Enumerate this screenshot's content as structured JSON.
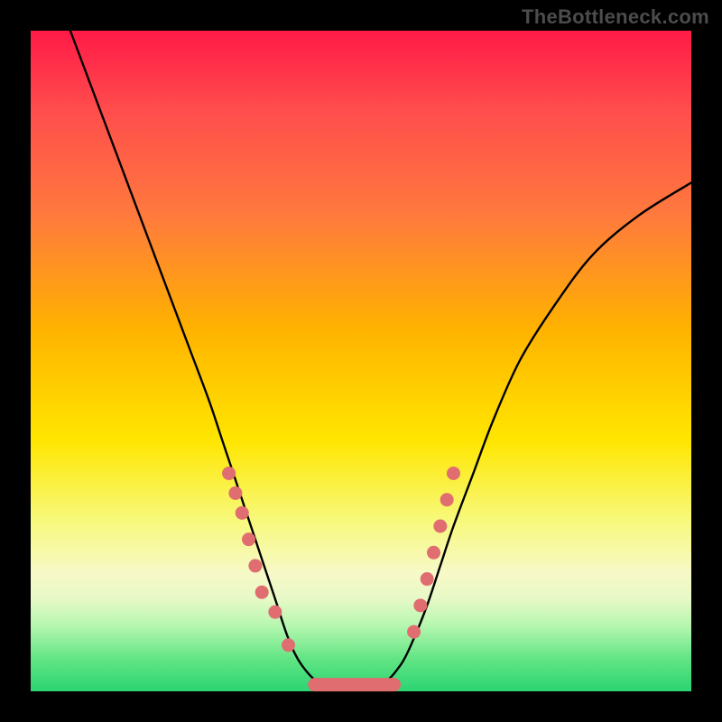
{
  "watermark": "TheBottleneck.com",
  "colors": {
    "page_bg": "#000000",
    "curve": "#000000",
    "marker": "#e06d70",
    "gradient_top": "#ff1a47",
    "gradient_bottom": "#2bd472"
  },
  "chart_data": {
    "type": "line",
    "title": "",
    "xlabel": "",
    "ylabel": "",
    "xlim": [
      0,
      100
    ],
    "ylim": [
      0,
      100
    ],
    "grid": false,
    "legend": false,
    "series": [
      {
        "name": "curve",
        "x": [
          6,
          9,
          12,
          15,
          18,
          21,
          24,
          27,
          29,
          31,
          33,
          35,
          37,
          39,
          41,
          44,
          48,
          53,
          56,
          58,
          60,
          62,
          64,
          67,
          70,
          74,
          79,
          85,
          92,
          100
        ],
        "y": [
          100,
          92,
          84,
          76,
          68,
          60,
          52,
          44,
          38,
          32,
          26,
          20,
          14,
          8,
          4,
          1,
          0,
          1,
          4,
          8,
          13,
          19,
          25,
          33,
          41,
          50,
          58,
          66,
          72,
          77
        ]
      }
    ],
    "markers": {
      "left_cluster": [
        [
          30,
          33
        ],
        [
          31,
          30
        ],
        [
          32,
          27
        ],
        [
          33,
          23
        ],
        [
          34,
          19
        ],
        [
          35,
          15
        ],
        [
          37,
          12
        ],
        [
          39,
          7
        ]
      ],
      "bottom_cluster": [
        [
          43,
          1.5
        ],
        [
          45,
          1
        ],
        [
          47,
          0.7
        ],
        [
          49,
          0.6
        ],
        [
          51,
          0.7
        ],
        [
          53,
          1
        ],
        [
          55,
          1.5
        ]
      ],
      "right_cluster": [
        [
          58,
          9
        ],
        [
          59,
          13
        ],
        [
          60,
          17
        ],
        [
          61,
          21
        ],
        [
          62,
          25
        ],
        [
          63,
          29
        ],
        [
          64,
          33
        ]
      ]
    }
  }
}
